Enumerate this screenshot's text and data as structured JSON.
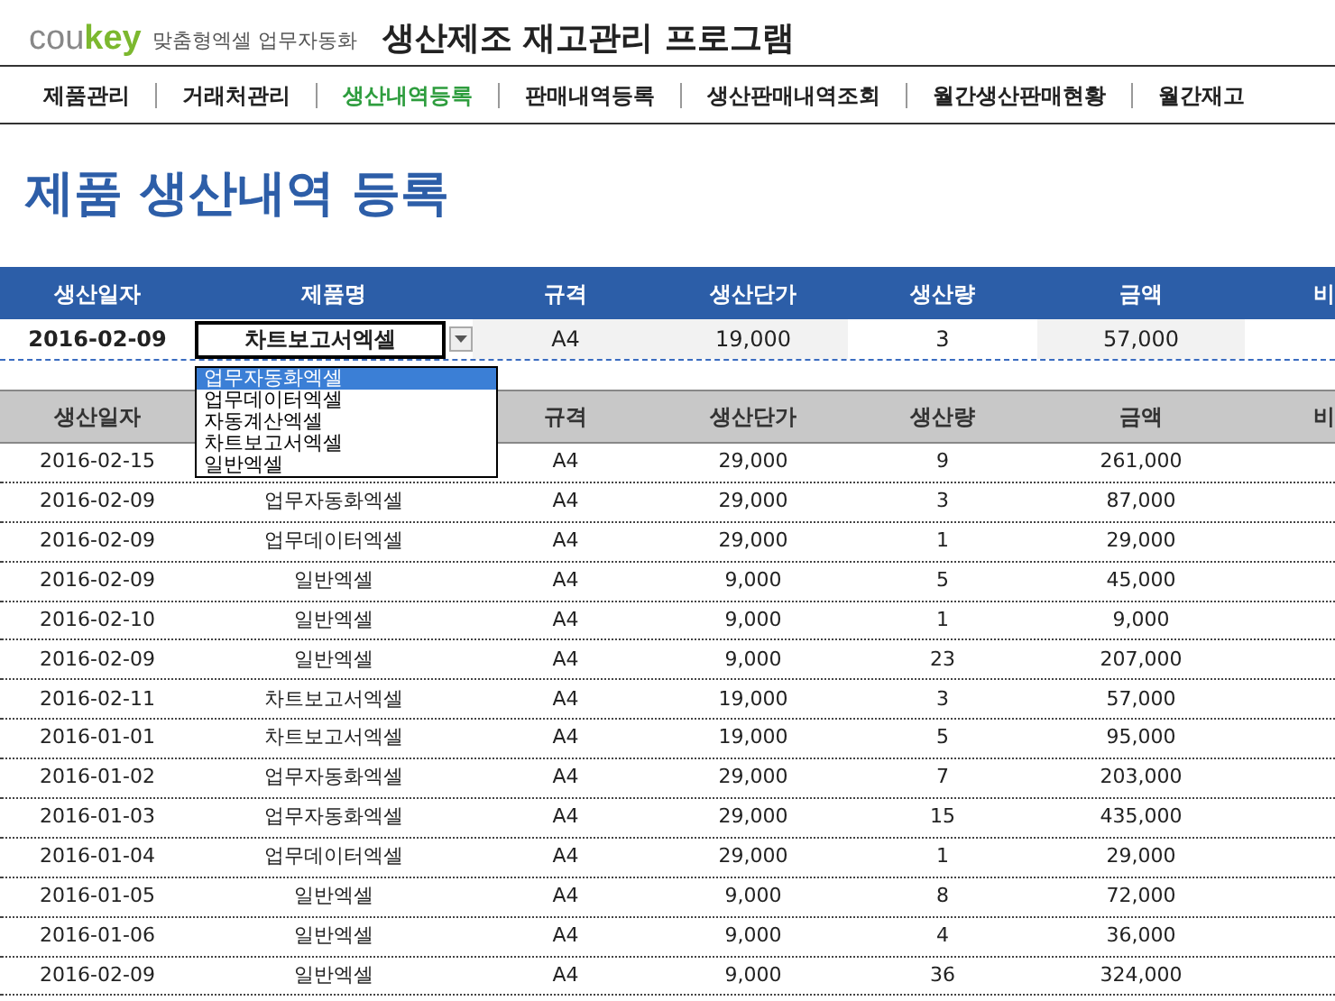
{
  "brand": {
    "logo_gray": "cou",
    "logo_green": "key",
    "tagline": "맞춤형엑셀 업무자동화"
  },
  "app_title": "생산제조 재고관리 프로그램",
  "nav": [
    {
      "label": "제품관리",
      "selected": false
    },
    {
      "label": "거래처관리",
      "selected": false
    },
    {
      "label": "생산내역등록",
      "selected": true
    },
    {
      "label": "판매내역등록",
      "selected": false
    },
    {
      "label": "생산판매내역조회",
      "selected": false
    },
    {
      "label": "월간생산판매현황",
      "selected": false
    },
    {
      "label": "월간재고",
      "selected": false
    }
  ],
  "page_title": "제품 생산내역 등록",
  "entry": {
    "columns": [
      "생산일자",
      "제품명",
      "규격",
      "생산단가",
      "생산량",
      "금액",
      "비"
    ],
    "values": [
      "2016-02-09",
      "차트보고서엑셀",
      "A4",
      "19,000",
      "3",
      "57,000"
    ],
    "dropdown": {
      "expanded": true,
      "options": [
        {
          "label": "업무자동화엑셀",
          "selected": true
        },
        {
          "label": "업무데이터엑셀",
          "selected": false
        },
        {
          "label": "자동계산엑셀",
          "selected": false
        },
        {
          "label": "차트보고서엑셀",
          "selected": false
        },
        {
          "label": "일반엑셀",
          "selected": false
        }
      ]
    }
  },
  "table": {
    "columns": [
      "생산일자",
      null,
      "규격",
      "생산단가",
      "생산량",
      "금액",
      "비"
    ],
    "rows": [
      [
        "2016-02-15",
        null,
        "A4",
        "29,000",
        "9",
        "261,000"
      ],
      [
        "2016-02-09",
        "업무자동화엑셀",
        "A4",
        "29,000",
        "3",
        "87,000"
      ],
      [
        "2016-02-09",
        "업무데이터엑셀",
        "A4",
        "29,000",
        "1",
        "29,000"
      ],
      [
        "2016-02-09",
        "일반엑셀",
        "A4",
        "9,000",
        "5",
        "45,000"
      ],
      [
        "2016-02-10",
        "일반엑셀",
        "A4",
        "9,000",
        "1",
        "9,000"
      ],
      [
        "2016-02-09",
        "일반엑셀",
        "A4",
        "9,000",
        "23",
        "207,000"
      ],
      [
        "2016-02-11",
        "차트보고서엑셀",
        "A4",
        "19,000",
        "3",
        "57,000"
      ],
      [
        "2016-01-01",
        "차트보고서엑셀",
        "A4",
        "19,000",
        "5",
        "95,000"
      ],
      [
        "2016-01-02",
        "업무자동화엑셀",
        "A4",
        "29,000",
        "7",
        "203,000"
      ],
      [
        "2016-01-03",
        "업무자동화엑셀",
        "A4",
        "29,000",
        "15",
        "435,000"
      ],
      [
        "2016-01-04",
        "업무데이터엑셀",
        "A4",
        "29,000",
        "1",
        "29,000"
      ],
      [
        "2016-01-05",
        "일반엑셀",
        "A4",
        "9,000",
        "8",
        "72,000"
      ],
      [
        "2016-01-06",
        "일반엑셀",
        "A4",
        "9,000",
        "4",
        "36,000"
      ],
      [
        "2016-02-09",
        "일반엑셀",
        "A4",
        "9,000",
        "36",
        "324,000"
      ]
    ]
  }
}
